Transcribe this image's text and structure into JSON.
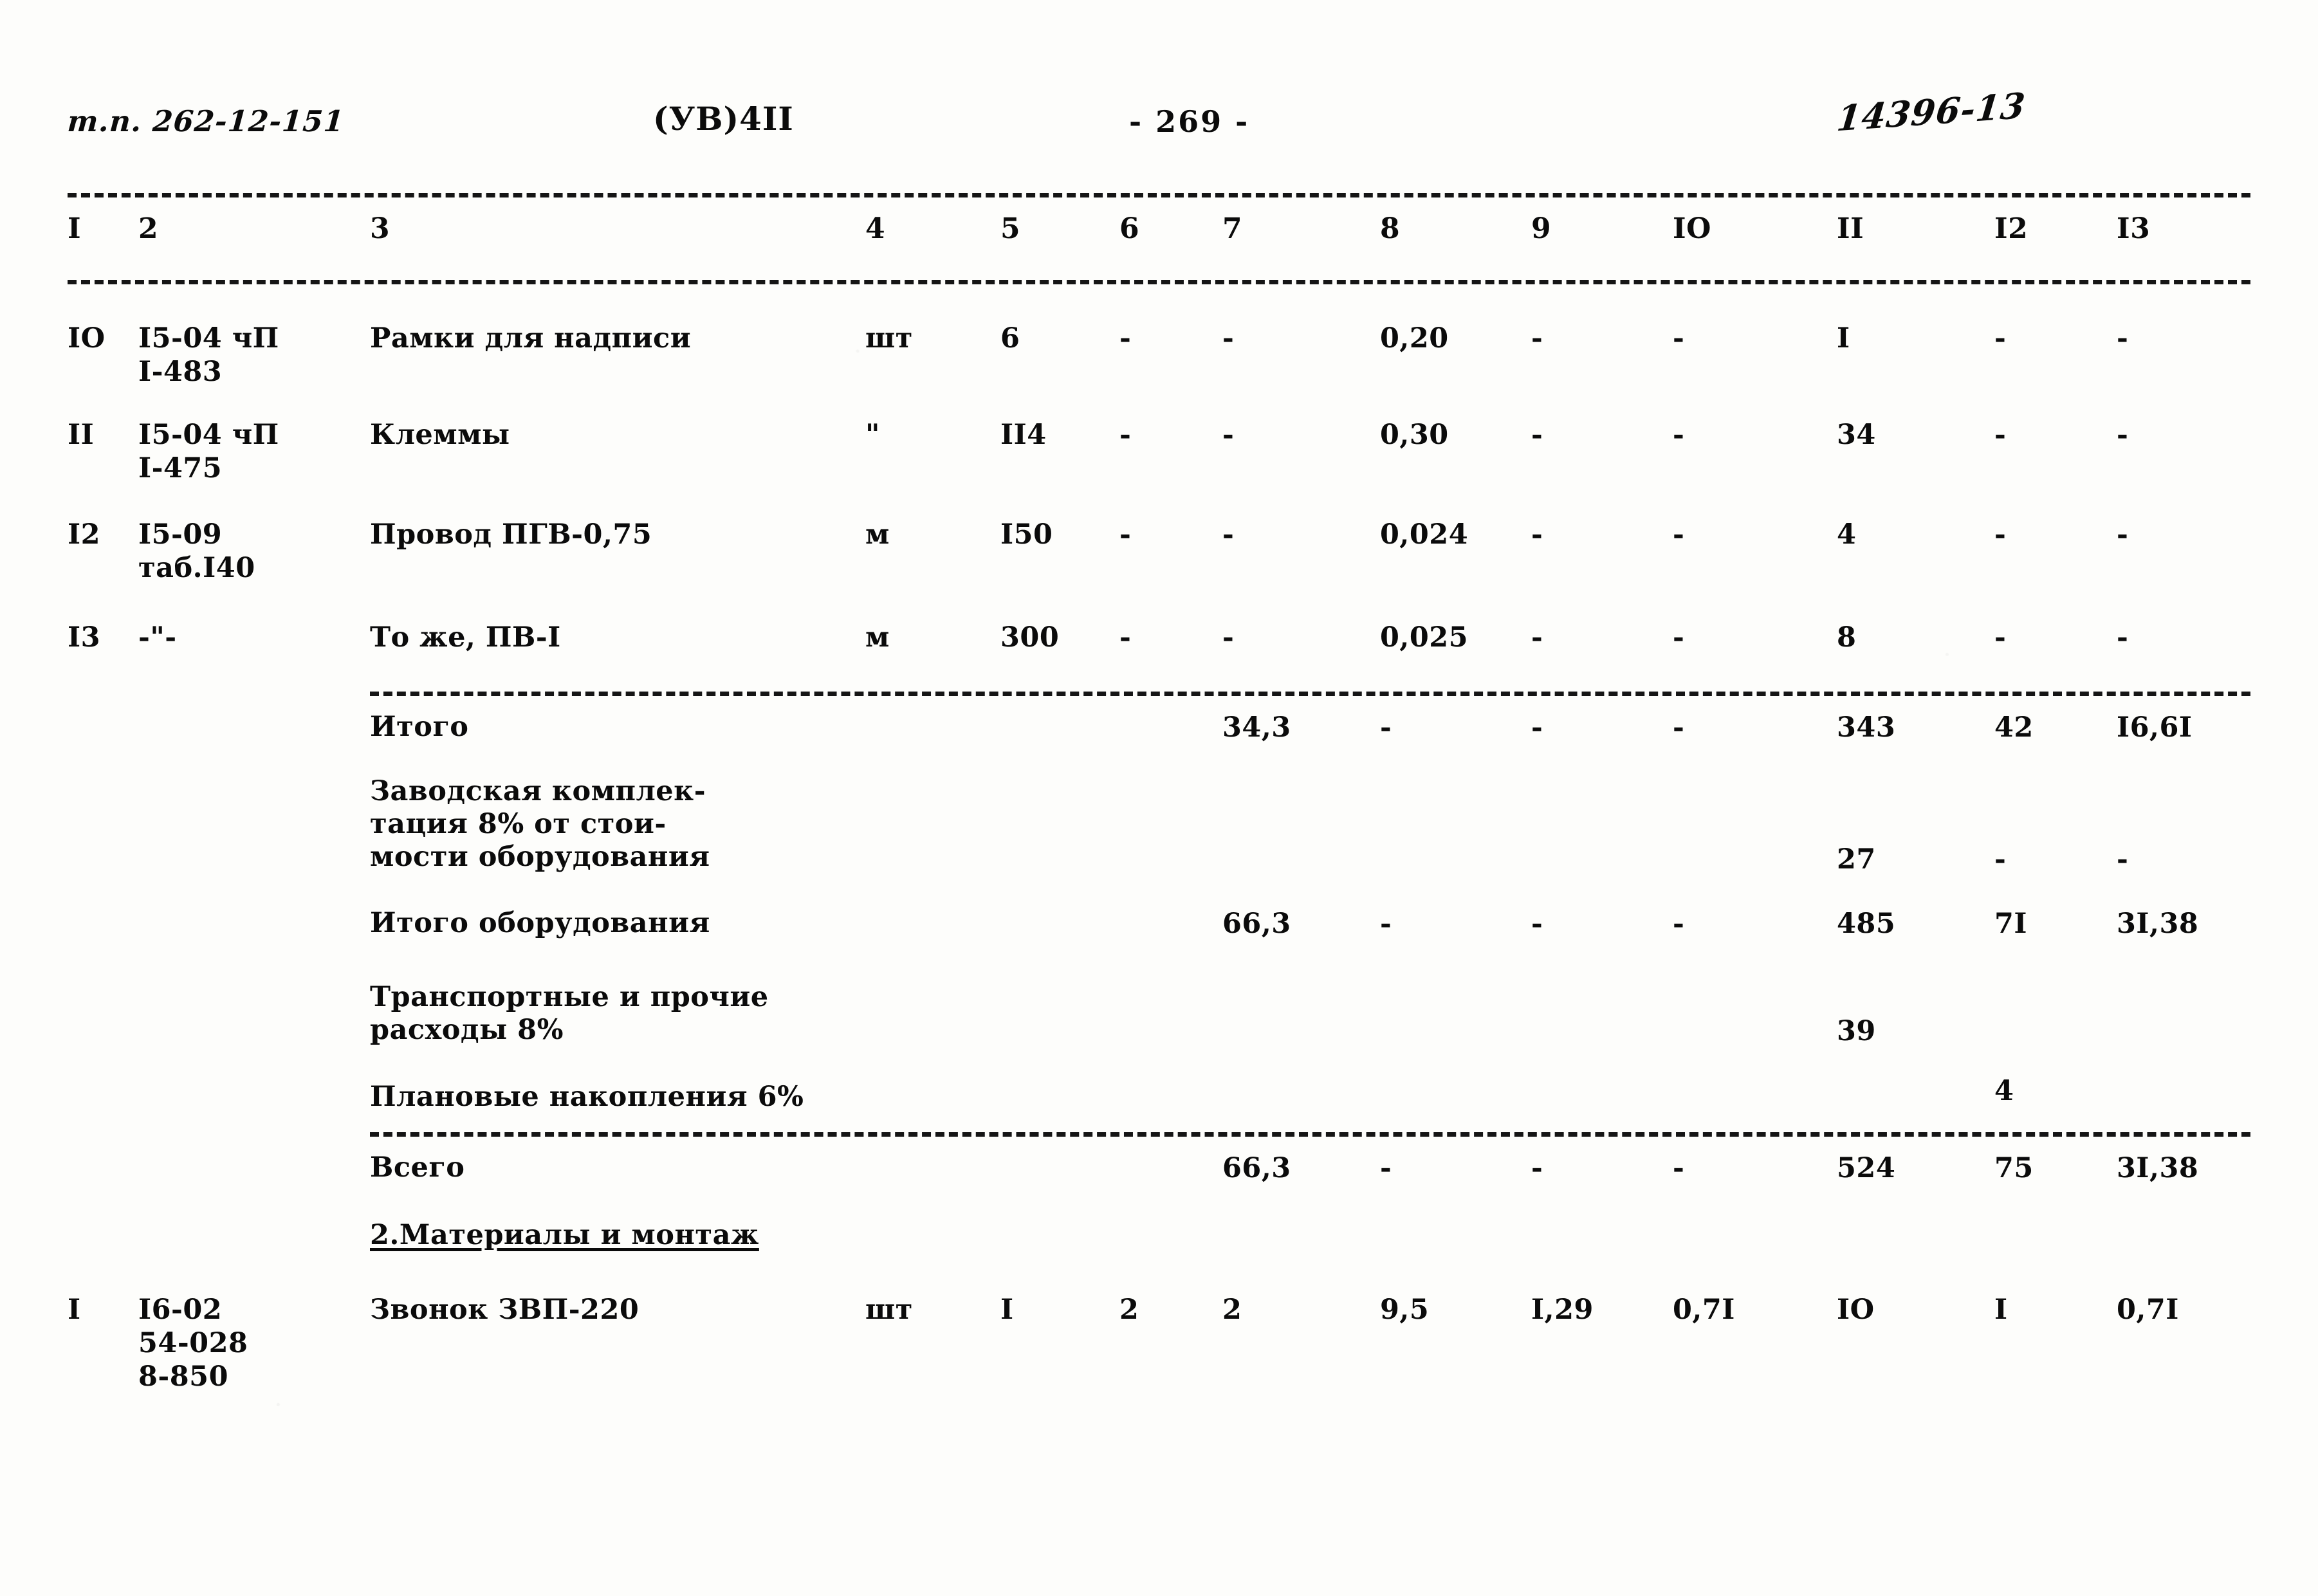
{
  "header": {
    "doc_code": "т.п. 262-12-151",
    "section_mark": "(УВ)4II",
    "page_number": "- 269 -",
    "handwritten_stamp": "14396-13"
  },
  "table": {
    "column_headers": [
      "I",
      "2",
      "3",
      "4",
      "5",
      "6",
      "7",
      "8",
      "9",
      "IO",
      "II",
      "I2",
      "I3"
    ],
    "rows": [
      {
        "c1": "IO",
        "c2": "I5-04 чП",
        "c2b": "I-483",
        "c3": "Рамки для надписи",
        "c4": "шт",
        "c5": "6",
        "c6": "-",
        "c7": "-",
        "c8": "0,20",
        "c9": "-",
        "c10": "-",
        "c11": "I",
        "c12": "-",
        "c13": "-"
      },
      {
        "c1": "II",
        "c2": "I5-04 чП",
        "c2b": "I-475",
        "c3": "Клеммы",
        "c4": "\"",
        "c5": "II4",
        "c6": "-",
        "c7": "-",
        "c8": "0,30",
        "c9": "-",
        "c10": "-",
        "c11": "34",
        "c12": "-",
        "c13": "-"
      },
      {
        "c1": "I2",
        "c2": "I5-09",
        "c2b": "таб.I40",
        "c3": "Провод ПГВ-0,75",
        "c4": "м",
        "c5": "I50",
        "c6": "-",
        "c7": "-",
        "c8": "0,024",
        "c9": "-",
        "c10": "-",
        "c11": "4",
        "c12": "-",
        "c13": "-"
      },
      {
        "c1": "I3",
        "c2": "-\"-",
        "c2b": "",
        "c3": "То же, ПВ-I",
        "c4": "м",
        "c5": "300",
        "c6": "-",
        "c7": "-",
        "c8": "0,025",
        "c9": "-",
        "c10": "-",
        "c11": "8",
        "c12": "-",
        "c13": "-"
      }
    ],
    "summary_rows": [
      {
        "label": "Итого",
        "c7": "34,3",
        "c8": "-",
        "c9": "-",
        "c10": "-",
        "c11": "343",
        "c12": "42",
        "c13": "I6,6I"
      },
      {
        "label": "Заводская комплек-\nтация 8% от стои-\nмости оборудования",
        "c7": "",
        "c8": "",
        "c9": "",
        "c10": "",
        "c11": "27",
        "c12": "-",
        "c13": "-"
      },
      {
        "label": "Итого оборудования",
        "c7": "66,3",
        "c8": "-",
        "c9": "-",
        "c10": "-",
        "c11": "485",
        "c12": "7I",
        "c13": "3I,38"
      },
      {
        "label": "Транспортные и прочие\nрасходы 8%",
        "c7": "",
        "c8": "",
        "c9": "",
        "c10": "",
        "c11": "39",
        "c12": "",
        "c13": ""
      },
      {
        "label": "Плановые накопления 6%",
        "c7": "",
        "c8": "",
        "c9": "",
        "c10": "",
        "c11": "",
        "c12": "4",
        "c13": ""
      },
      {
        "label": "Всего",
        "c7": "66,3",
        "c8": "-",
        "c9": "-",
        "c10": "-",
        "c11": "524",
        "c12": "75",
        "c13": "3I,38"
      }
    ],
    "section_heading": "2.Материалы и монтаж",
    "last_row": {
      "c1": "I",
      "c2": "I6-02",
      "c2b": "54-028",
      "c2c": "8-850",
      "c3": "Звонок ЗВП-220",
      "c4": "шт",
      "c5": "I",
      "c6": "2",
      "c7": "2",
      "c8": "9,5",
      "c9": "I,29",
      "c10": "0,7I",
      "c11": "IO",
      "c12": "I",
      "c13": "0,7I"
    }
  }
}
